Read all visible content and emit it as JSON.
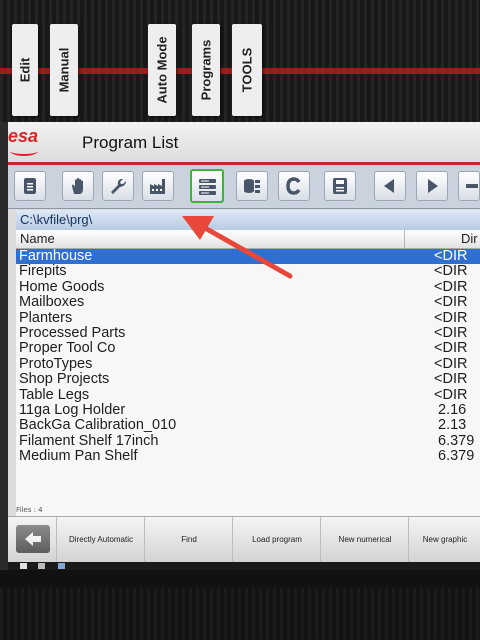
{
  "panel_tabs": [
    "Edit",
    "Manual",
    "Auto Mode",
    "Programs",
    "TOOLS"
  ],
  "window": {
    "logo_text": "esa",
    "title": "Program List"
  },
  "toolbar_icons": [
    "document-icon",
    "hand-icon",
    "wrench-icon",
    "factory-icon",
    "program-list-icon",
    "database-icon",
    "c-icon",
    "save-icon",
    "arrow-left-icon",
    "arrow-right-icon",
    "minus-icon"
  ],
  "path": "C:\\kvfile\\prg\\",
  "columns": {
    "name": "Name",
    "dim": "Dir"
  },
  "files": [
    {
      "name": "Farmhouse",
      "size": "<DIR",
      "selected": true
    },
    {
      "name": "Firepits",
      "size": "<DIR"
    },
    {
      "name": "Home Goods",
      "size": "<DIR"
    },
    {
      "name": "Mailboxes",
      "size": "<DIR"
    },
    {
      "name": "Planters",
      "size": "<DIR"
    },
    {
      "name": "Processed Parts",
      "size": "<DIR"
    },
    {
      "name": "Proper Tool Co",
      "size": "<DIR"
    },
    {
      "name": "ProtoTypes",
      "size": "<DIR"
    },
    {
      "name": "Shop Projects",
      "size": "<DIR"
    },
    {
      "name": "Table Legs",
      "size": "<DIR"
    },
    {
      "name": "11ga Log Holder",
      "size": "2.16"
    },
    {
      "name": "BackGa Calibration_010",
      "size": "2.13"
    },
    {
      "name": "Filament Shelf 17inch",
      "size": "6.379"
    },
    {
      "name": "Medium Pan Shelf",
      "size": "6.379"
    }
  ],
  "status": "Files : 4",
  "softkeys": [
    "Directly Automatic",
    "Find",
    "Load program",
    "New numerical",
    "New graphic"
  ],
  "colors": {
    "accent": "#c8282c",
    "selection": "#2f6fd0",
    "annotation_arrow": "#e8473a",
    "selected_tool_border": "#3fb23a"
  }
}
